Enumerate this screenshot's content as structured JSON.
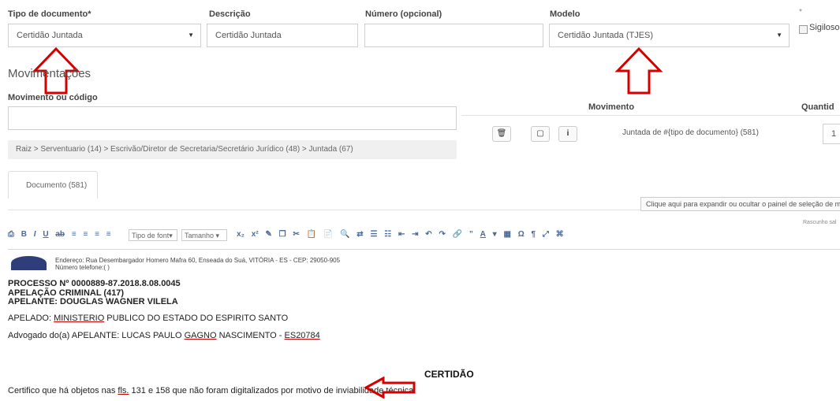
{
  "form": {
    "tipo_label": "Tipo de documento*",
    "tipo_value": "Certidão  Juntada",
    "descricao_label": "Descrição",
    "descricao_value": "Certidão  Juntada",
    "numero_label": "Número (opcional)",
    "numero_value": "",
    "modelo_label": "Modelo",
    "modelo_value": "Certidão  Juntada (TJES)",
    "sigilo_star": "*",
    "sigiloso_label": "Sigiloso"
  },
  "movimentacoes": {
    "title": "Movimentações",
    "movimento_label": "Movimento ou código",
    "breadcrumb": "Raiz > Serventuario (14) > Escrivão/Diretor de Secretaria/Secretário Jurídico (48) > Juntada (67)",
    "col_movimento": "Movimento",
    "col_quantidade": "Quantid",
    "row_text": "Juntada de #{tipo  de  documento} (581)",
    "row_qty": "1"
  },
  "tabs": {
    "documento": "Documento (581)"
  },
  "panel_hint": "Clique aqui para expandir ou ocultar o painel de seleção de movim",
  "rascunho": "Rascunho sal",
  "toolbar": {
    "font_label": "Tipo de font",
    "size_label": "Tamanho"
  },
  "document": {
    "address": "Endereço: Rua Desembargador Homero Mafra 60, Enseada do Suá, VITÓRIA - ES - CEP: 29050-905",
    "phone": "Número telefone:(  )",
    "processo": "PROCESSO Nº 0000889-87.2018.8.08.0045",
    "apelacao": "APELAÇÃO CRIMINAL (417)",
    "apelante": "APELANTE: DOUGLAS WAGNER VILELA",
    "apelado_pre": "APELADO: ",
    "apelado_under": "MINISTERIO",
    "apelado_post": " PUBLICO DO ESTADO DO ESPIRITO SANTO",
    "advogado_pre": "Advogado do(a) APELANTE: LUCAS PAULO ",
    "advogado_under1": "GAGNO",
    "advogado_mid": " NASCIMENTO - ",
    "advogado_under2": "ES20784",
    "certidao_title": "CERTIDÃO",
    "cert_pre": "Certifico que há objetos nas ",
    "cert_under": "fls.",
    "cert_post": " 131 e 158 que não foram digitalizados por motivo de inviabilidade técnica."
  },
  "colors": {
    "arrow": "#d40000",
    "accent": "#4b6b9b"
  }
}
